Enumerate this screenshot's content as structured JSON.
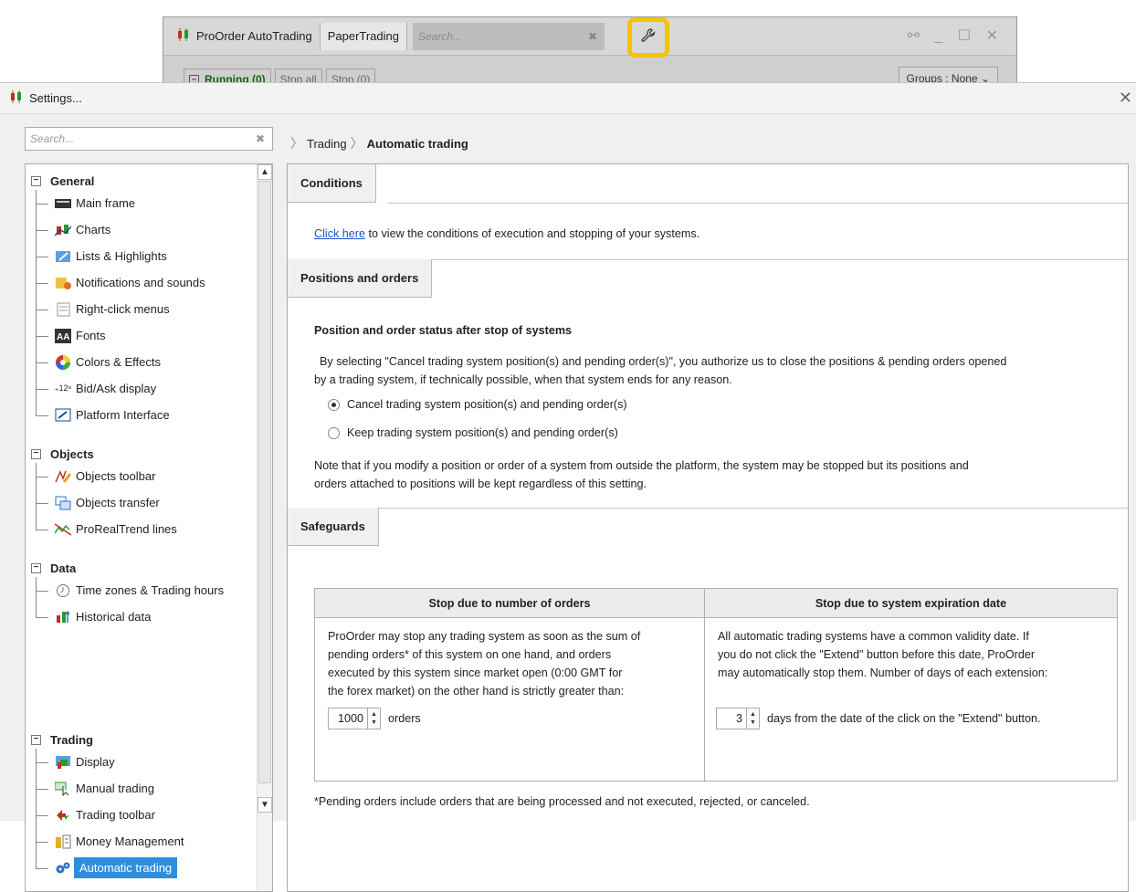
{
  "background_window": {
    "tabs": [
      "ProOrder AutoTrading",
      "PaperTrading"
    ],
    "search_placeholder": "Search...",
    "running_label": "Running (0)",
    "stop_all_label": "Stop all",
    "stop_count_label": "Stop (0)",
    "groups_label": "Groups : None"
  },
  "settings": {
    "title": "Settings...",
    "search_placeholder": "Search...",
    "breadcrumb": [
      "Trading",
      "Automatic trading"
    ],
    "tree": {
      "general": {
        "title": "General",
        "items": [
          "Main frame",
          "Charts",
          "Lists & Highlights",
          "Notifications and sounds",
          "Right-click menus",
          "Fonts",
          "Colors & Effects",
          "Bid/Ask display",
          "Platform Interface"
        ]
      },
      "objects": {
        "title": "Objects",
        "items": [
          "Objects toolbar",
          "Objects transfer",
          "ProRealTrend lines"
        ]
      },
      "data": {
        "title": "Data",
        "items": [
          "Time zones & Trading hours",
          "Historical data"
        ]
      },
      "trading": {
        "title": "Trading",
        "items": [
          "Display",
          "Manual trading",
          "Trading toolbar",
          "Money Management",
          "Automatic trading"
        ]
      }
    },
    "conditions": {
      "tab": "Conditions",
      "link": "Click here",
      "text": " to view the conditions of execution and stopping of your systems."
    },
    "positions": {
      "tab": "Positions and orders",
      "heading": "Position and order status after stop of systems",
      "para1a": "By selecting \"Cancel trading system position(s) and pending order(s)\", you authorize us to close the positions & pending orders opened",
      "para1b": "by a trading system, if technically possible, when that system ends for any reason.",
      "radio_cancel": "Cancel trading system position(s) and pending order(s)",
      "radio_keep": "Keep trading system position(s) and pending order(s)",
      "note_a": "Note that if you modify a position or order of a system from outside the platform, the system may be stopped but its positions and",
      "note_b": "orders attached to positions will be kept regardless of this setting."
    },
    "safeguards": {
      "tab": "Safeguards",
      "col1_head": "Stop due to number of orders",
      "col1_l1": "ProOrder may stop any trading system as soon as the sum of",
      "col1_l2": "pending orders* of this system on one hand, and orders",
      "col1_l3": "executed by this system since market open (0:00 GMT for",
      "col1_l4": "the forex market) on the other hand is strictly greater than:",
      "col1_value": "1000",
      "col1_unit": "orders",
      "col2_head": "Stop due to system expiration date",
      "col2_l1": "All automatic trading systems have a common validity date. If",
      "col2_l2": "you do not click the \"Extend\" button before this date, ProOrder",
      "col2_l3": "may automatically stop them. Number of days of each extension:",
      "col2_value": "3",
      "col2_unit": "days from the date of the click on the \"Extend\" button.",
      "footnote": "*Pending orders include orders that are being processed and not executed, rejected, or canceled."
    }
  },
  "colors": {
    "highlight": "#f5c400",
    "selected": "#2d8ee0",
    "link": "#1a55c8"
  }
}
